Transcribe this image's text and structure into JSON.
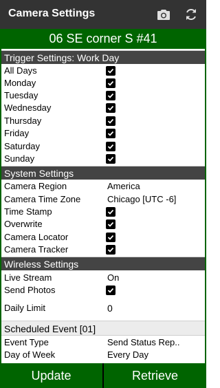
{
  "app_bar": {
    "title": "Camera Settings",
    "icons": [
      "camera-icon",
      "refresh-icon"
    ]
  },
  "camera_name": "06 SE corner S #41",
  "trigger": {
    "header": "Trigger Settings: Work Day",
    "days": [
      {
        "label": "All Days",
        "checked": true
      },
      {
        "label": "Monday",
        "checked": true
      },
      {
        "label": "Tuesday",
        "checked": true
      },
      {
        "label": "Wednesday",
        "checked": true
      },
      {
        "label": "Thursday",
        "checked": true
      },
      {
        "label": "Friday",
        "checked": true
      },
      {
        "label": "Saturday",
        "checked": true
      },
      {
        "label": "Sunday",
        "checked": true
      }
    ]
  },
  "system": {
    "header": "System Settings",
    "region_label": "Camera Region",
    "region_value": "America",
    "timezone_label": "Camera Time Zone",
    "timezone_value": "Chicago [UTC -6]",
    "timestamp_label": "Time Stamp",
    "overwrite_label": "Overwrite",
    "locator_label": "Camera Locator",
    "tracker_label": "Camera Tracker"
  },
  "wireless": {
    "header": "Wireless Settings",
    "livestream_label": "Live Stream",
    "livestream_value": "On",
    "sendphotos_label": "Send Photos",
    "dailylimit_label": "Daily Limit",
    "dailylimit_value": "0"
  },
  "scheduled": {
    "header": "Scheduled Event [01]",
    "eventtype_label": "Event Type",
    "eventtype_value": "Send Status Rep..",
    "dayofweek_label": "Day of Week",
    "dayofweek_value": "Every Day"
  },
  "buttons": {
    "update": "Update",
    "retrieve": "Retrieve"
  },
  "colors": {
    "app_bar": "#333333",
    "brand_green": "#006400",
    "section_header": "#444444"
  }
}
